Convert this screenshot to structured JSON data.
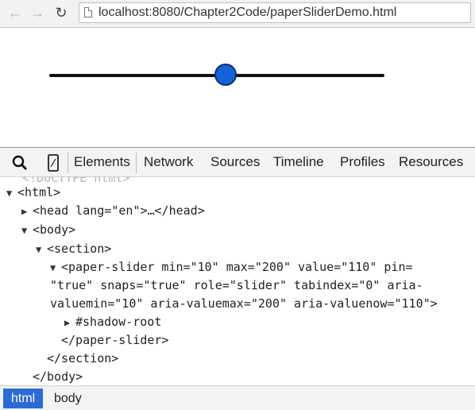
{
  "browser": {
    "url": "localhost:8080/Chapter2Code/paperSliderDemo.html",
    "back_icon": "arrow-left-icon",
    "forward_icon": "arrow-right-icon",
    "reload_icon": "reload-icon"
  },
  "slider": {
    "min": 10,
    "max": 200,
    "value": 110,
    "knob_color": "#1464d8"
  },
  "devtools": {
    "tabs": [
      "Elements",
      "Network",
      "Sources",
      "Timeline",
      "Profiles",
      "Resources"
    ],
    "selected_tab": "Elements",
    "ghost": "<!DOCTYPE html>",
    "tree": {
      "html": "<html>",
      "head": "<head lang=\"en\">…</head>",
      "body": "<body>",
      "section": "<section>",
      "slider_line1": "<paper-slider min=\"10\" max=\"200\" value=\"110\" pin=",
      "slider_line2": "\"true\" snaps=\"true\" role=\"slider\" tabindex=\"0\" aria-",
      "slider_line3": "valuemin=\"10\" aria-valuemax=\"200\" aria-valuenow=\"110\">",
      "shadow_root": "#shadow-root",
      "slider_close": "</paper-slider>",
      "section_close": "</section>",
      "body_close": "</body>"
    },
    "breadcrumbs": [
      "html",
      "body"
    ],
    "accent": "#2b6bd6"
  }
}
